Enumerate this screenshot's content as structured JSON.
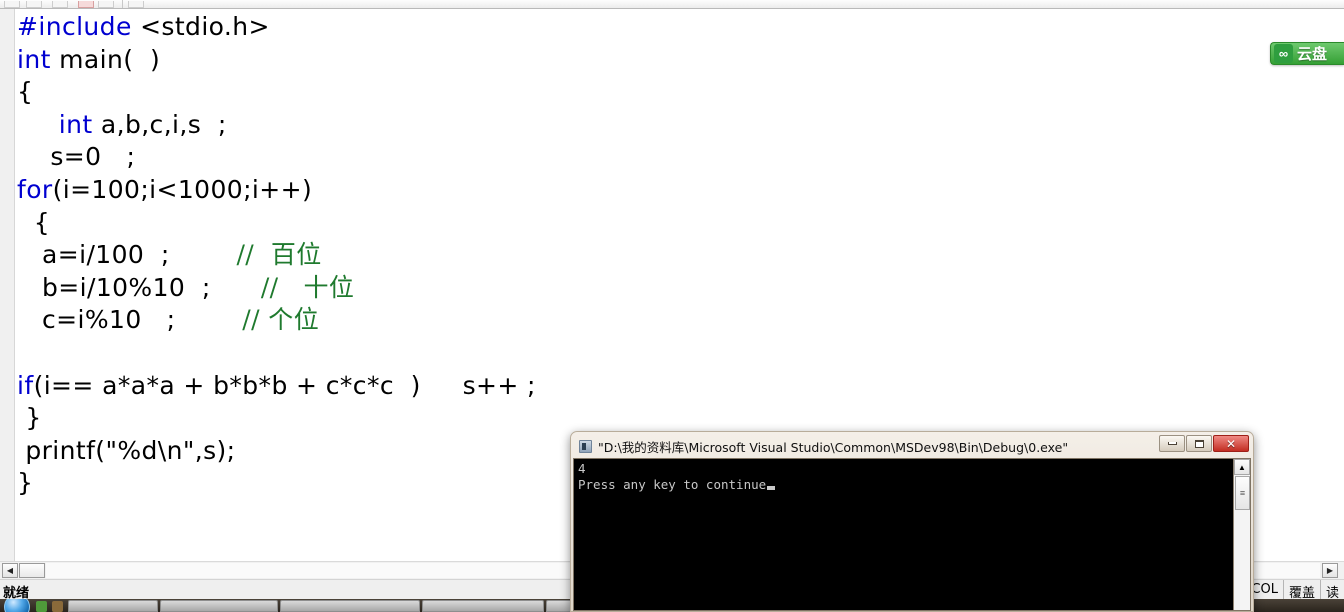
{
  "toolbar": {
    "note": ""
  },
  "editor": {
    "code_lines": [
      {
        "id": "l1",
        "segments": [
          {
            "t": "#include",
            "c": "kw"
          },
          {
            "t": " <stdio.h>",
            "c": ""
          }
        ]
      },
      {
        "id": "l2",
        "segments": [
          {
            "t": "int",
            "c": "kw"
          },
          {
            "t": " main(  )",
            "c": ""
          }
        ]
      },
      {
        "id": "l3",
        "segments": [
          {
            "t": "{",
            "c": ""
          }
        ]
      },
      {
        "id": "l4",
        "segments": [
          {
            "t": "     ",
            "c": ""
          },
          {
            "t": "int",
            "c": "kw"
          },
          {
            "t": " a,b,c,i,s  ;",
            "c": ""
          }
        ]
      },
      {
        "id": "l5",
        "segments": [
          {
            "t": "    s=0   ;",
            "c": ""
          }
        ]
      },
      {
        "id": "l6",
        "segments": [
          {
            "t": "for",
            "c": "kw"
          },
          {
            "t": "(i=100;i<1000;i++)",
            "c": ""
          }
        ]
      },
      {
        "id": "l7",
        "segments": [
          {
            "t": "  {",
            "c": ""
          }
        ]
      },
      {
        "id": "l8",
        "segments": [
          {
            "t": "   a=i/100  ;        ",
            "c": ""
          },
          {
            "t": "//  百位",
            "c": "cm"
          }
        ]
      },
      {
        "id": "l9",
        "segments": [
          {
            "t": "   b=i/10%10  ;      ",
            "c": ""
          },
          {
            "t": "//   十位",
            "c": "cm"
          }
        ]
      },
      {
        "id": "l10",
        "segments": [
          {
            "t": "   c=i%10   ;        ",
            "c": ""
          },
          {
            "t": "// 个位",
            "c": "cm"
          }
        ]
      },
      {
        "id": "l11",
        "segments": [
          {
            "t": "",
            "c": ""
          }
        ]
      },
      {
        "id": "l12",
        "segments": [
          {
            "t": "if",
            "c": "kw"
          },
          {
            "t": "(i== a*a*a + b*b*b + c*c*c  )     s++ ;",
            "c": ""
          }
        ]
      },
      {
        "id": "l13",
        "segments": [
          {
            "t": " }",
            "c": ""
          }
        ]
      },
      {
        "id": "l14",
        "segments": [
          {
            "t": " printf(\"%d\\n\",s);",
            "c": ""
          }
        ]
      },
      {
        "id": "l15",
        "segments": [
          {
            "t": "}",
            "c": ""
          }
        ]
      }
    ],
    "colors": {
      "keyword": "#0000d0",
      "comment": "#1f7a2e",
      "text": "#000000",
      "background": "#ffffff"
    }
  },
  "cloud_badge": {
    "icon": "cloud-disk-icon",
    "label": "云盘"
  },
  "hscrollbar": {
    "left_arrow": "◀",
    "right_arrow": "▶"
  },
  "statusbar": {
    "ready_label": "就绪",
    "panes": [
      {
        "name": "col",
        "label": "COL"
      },
      {
        "name": "overwrite",
        "label": "覆盖"
      },
      {
        "name": "read",
        "label": "读"
      }
    ]
  },
  "console": {
    "title": "\"D:\\我的资料库\\Microsoft Visual Studio\\Common\\MSDev98\\Bin\\Debug\\0.exe\"",
    "buttons": {
      "minimize": "─",
      "maximize": "□",
      "close": "✕"
    },
    "output_lines": [
      "4",
      "Press any key to continue"
    ],
    "scrollbar": {
      "up_arrow": "▲",
      "thumb_glyph": "≡"
    },
    "colors": {
      "background": "#000000",
      "text": "#c8c8c8",
      "close": "#c22d22"
    }
  },
  "taskbar": {
    "start_label": "start-orb"
  }
}
